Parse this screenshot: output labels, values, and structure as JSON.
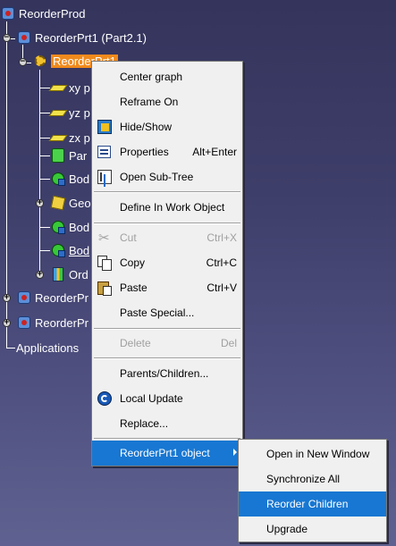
{
  "tree": {
    "root": "ReorderProd",
    "part1": "ReorderPrt1 (Part2.1)",
    "selected_part": "ReorderPrt1",
    "children": [
      {
        "label": "xy p",
        "icon": "plane-icon"
      },
      {
        "label": "yz p",
        "icon": "plane-icon"
      },
      {
        "label": "zx p",
        "icon": "plane-icon"
      },
      {
        "label": "Par",
        "icon": "parameters-icon"
      },
      {
        "label": "Bod",
        "icon": "body-icon"
      },
      {
        "label": "Geo",
        "icon": "geometrical-set-icon"
      },
      {
        "label": "Bod",
        "icon": "body-icon"
      },
      {
        "label": "Bod",
        "icon": "body-icon"
      },
      {
        "label": "Ord",
        "icon": "ordered-set-icon"
      }
    ],
    "sibling_parts": [
      "ReorderPr",
      "ReorderPr"
    ],
    "applications": "Applications"
  },
  "context_menu": {
    "items": [
      {
        "label": "Center graph",
        "shortcut": ""
      },
      {
        "label": "Reframe On",
        "shortcut": ""
      },
      {
        "label": "Hide/Show",
        "shortcut": ""
      },
      {
        "label": "Properties",
        "shortcut": "Alt+Enter"
      },
      {
        "label": "Open Sub-Tree",
        "shortcut": ""
      },
      {
        "label": "Define In Work Object",
        "shortcut": ""
      },
      {
        "label": "Cut",
        "shortcut": "Ctrl+X",
        "disabled": true
      },
      {
        "label": "Copy",
        "shortcut": "Ctrl+C"
      },
      {
        "label": "Paste",
        "shortcut": "Ctrl+V"
      },
      {
        "label": "Paste Special...",
        "shortcut": ""
      },
      {
        "label": "Delete",
        "shortcut": "Del",
        "disabled": true
      },
      {
        "label": "Parents/Children...",
        "shortcut": ""
      },
      {
        "label": "Local Update",
        "shortcut": ""
      },
      {
        "label": "Replace...",
        "shortcut": ""
      },
      {
        "label": "ReorderPrt1 object",
        "shortcut": "",
        "submenu": true
      }
    ]
  },
  "submenu": {
    "items": [
      {
        "label": "Open in New Window"
      },
      {
        "label": "Synchronize All"
      },
      {
        "label": "Reorder Children"
      },
      {
        "label": "Upgrade"
      }
    ]
  },
  "colors": {
    "selection": "#f08a1c",
    "menu_highlight": "#1877d2",
    "menu_bg": "#f0f0f0"
  }
}
